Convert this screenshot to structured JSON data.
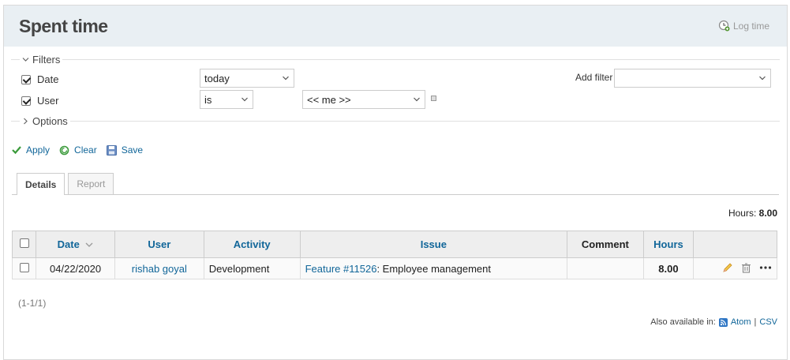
{
  "header": {
    "title": "Spent time",
    "log_time_label": "Log time"
  },
  "filters": {
    "legend": "Filters",
    "rows": [
      {
        "label": "Date",
        "checked": true,
        "operator": "today"
      },
      {
        "label": "User",
        "checked": true,
        "operator": "is",
        "value": "<< me >>"
      }
    ],
    "add_filter_label": "Add filter",
    "add_filter_value": ""
  },
  "options": {
    "legend": "Options"
  },
  "actions": {
    "apply": "Apply",
    "clear": "Clear",
    "save": "Save"
  },
  "tabs": [
    {
      "label": "Details",
      "active": true
    },
    {
      "label": "Report",
      "active": false
    }
  ],
  "totals": {
    "label": "Hours:",
    "value": "8.00"
  },
  "table": {
    "columns": [
      "Date",
      "User",
      "Activity",
      "Issue",
      "Comment",
      "Hours"
    ],
    "rows": [
      {
        "date": "04/22/2020",
        "user": "rishab goyal",
        "activity": "Development",
        "issue_link": "Feature #11526",
        "issue_subject": ": Employee management",
        "comment": "",
        "hours": "8.00"
      }
    ]
  },
  "pagination": "(1-1/1)",
  "other_formats": {
    "label": "Also available in:",
    "atom": "Atom",
    "separator": "|",
    "csv": "CSV"
  },
  "colors": {
    "link": "#116699",
    "header_bg": "#e9eff3",
    "apply_check": "#3a9a3a"
  }
}
